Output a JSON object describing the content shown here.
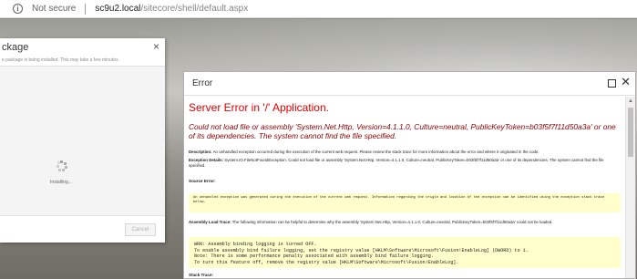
{
  "browser": {
    "security_label": "Not secure",
    "url_host": "sc9u2.local",
    "url_path": "/sitecore/shell/default.aspx"
  },
  "package_dialog": {
    "title": "ckage",
    "subtitle": "e package is being installed. This may take a few minutes.",
    "close_glyph": "×",
    "status": "Installing...",
    "cancel_label": "Cancel"
  },
  "error_window": {
    "title": "Error",
    "maximize_glyph": "☐",
    "close_glyph": "✕",
    "heading": "Server Error in '/' Application.",
    "subheading": "Could not load file or assembly 'System.Net.Http, Version=4.1.1.0, Culture=neutral, PublicKeyToken=b03f5f7f11d50a3a' or one of its dependencies. The system cannot find the file specified.",
    "description_label": "Description:",
    "description": "An unhandled exception occurred during the execution of the current web request. Please review the stack trace for more information about the error and where it originated in the code.",
    "exception_label": "Exception Details:",
    "exception": "System.IO.FileNotFoundException: Could not load file or assembly 'System.Net.Http, Version=4.1.1.0, Culture=neutral, PublicKeyToken=b03f5f7f11d50a3a' or one of its dependencies. The system cannot find the file specified.",
    "source_error_label": "Source Error:",
    "source_error": "An unhandled exception was generated during the execution of the current web request. Information regarding the origin and location of the exception can be identified using the exception stack trace below.",
    "assembly_label": "Assembly Load Trace:",
    "assembly_trace": "The following information can be helpful to determine why the assembly 'System.Net.Http, Version=4.1.1.0, Culture=neutral, PublicKeyToken=b03f5f7f11d50a3a' could not be loaded.",
    "log_lines": [
      "WRN: Assembly binding logging is turned OFF.",
      "To enable assembly bind failure logging, set the registry value [HKLM\\Software\\Microsoft\\Fusion!EnableLog] (DWORD) to 1.",
      "Note: There is some performance penalty associated with assembly bind failure logging.",
      "To turn this feature off, remove the registry value [HKLM\\Software\\Microsoft\\Fusion!EnableLog]."
    ],
    "stack_trace_label": "Stack Trace:"
  }
}
